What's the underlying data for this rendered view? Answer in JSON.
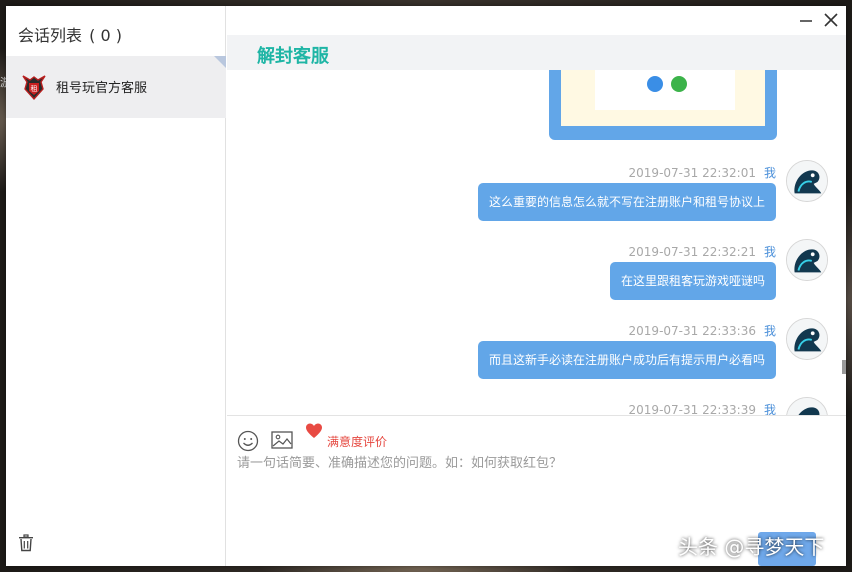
{
  "sidebar": {
    "title": "会话列表",
    "count": "( 0 )",
    "sessions": [
      {
        "name": "租号玩官方客服"
      }
    ]
  },
  "chat": {
    "title": "解封客服",
    "messages": [
      {
        "timestamp": "2019-07-31 22:32:01",
        "sender": "我",
        "text": "这么重要的信息怎么就不写在注册账户和租号协议上"
      },
      {
        "timestamp": "2019-07-31 22:32:21",
        "sender": "我",
        "text": "在这里跟租客玩游戏哑谜吗"
      },
      {
        "timestamp": "2019-07-31 22:33:36",
        "sender": "我",
        "text": "而且这新手必读在注册账户成功后有提示用户必看吗"
      },
      {
        "timestamp": "2019-07-31 22:33:39",
        "sender": "我"
      }
    ]
  },
  "composer": {
    "rating_label": "满意度评价",
    "placeholder": "请一句话简要、准确描述您的问题。如：如何获取红包？"
  },
  "watermark": "头条 @寻梦天下",
  "colors": {
    "accent_teal": "#1fb5a5",
    "bubble_blue": "#62a6e8",
    "rating_red": "#e5473f"
  },
  "icons": [
    "trash-icon",
    "minimize-icon",
    "close-icon",
    "emoji-icon",
    "image-icon",
    "heart-icon"
  ]
}
